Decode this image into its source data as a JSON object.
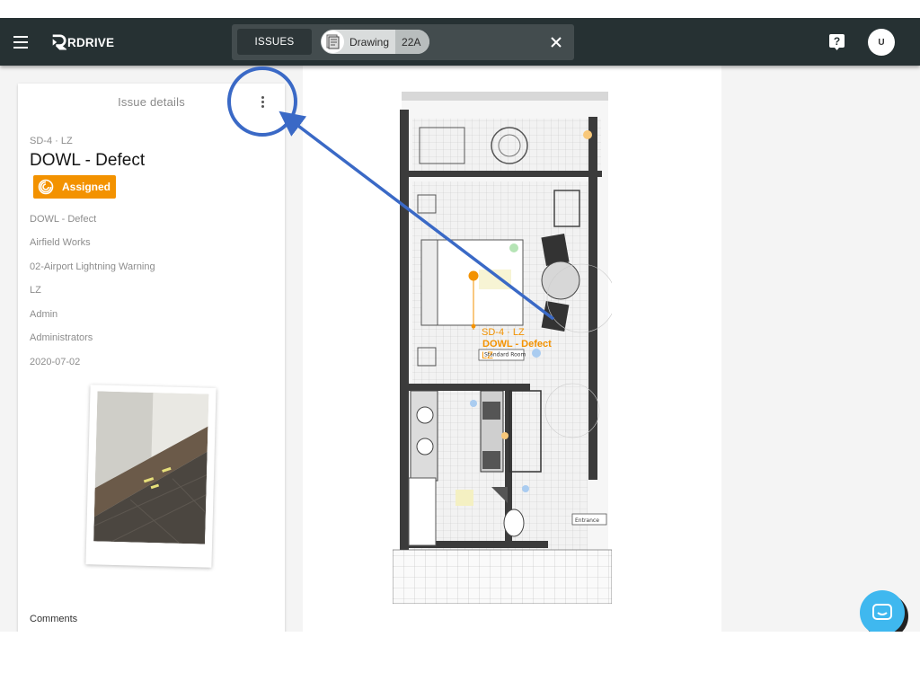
{
  "header": {
    "logo_text": "RDRIVE",
    "issues_tab": "ISSUES",
    "drawing_chip_label": "Drawing",
    "drawing_chip_count": "22A",
    "user_initial": "U"
  },
  "panel": {
    "title": "Issue details",
    "issue_code": "SD-4 · LZ",
    "issue_title": "DOWL - Defect",
    "status": "Assigned",
    "fields": [
      "DOWL - Defect",
      "Airfield Works",
      "02-Airport Lightning Warning",
      "LZ",
      "Admin",
      "Administrators",
      "2020-07-02"
    ],
    "comments_label": "Comments"
  },
  "drawing": {
    "pin_code": "SD-4 · LZ",
    "pin_title": "DOWL - Defect",
    "pin_zone": "LZ",
    "room_label": "Standard Room",
    "entrance_label": "Entrance"
  },
  "colors": {
    "topbar": "#263133",
    "accent_orange": "#f39200",
    "annotation_blue": "#3a69c6",
    "chat_blue": "#3fb8ef"
  },
  "icons": [
    "menu-icon",
    "logo-icon",
    "drawing-thumbnail-icon",
    "close-icon",
    "help-icon",
    "more-vert-icon",
    "assigned-status-icon",
    "chat-icon"
  ]
}
